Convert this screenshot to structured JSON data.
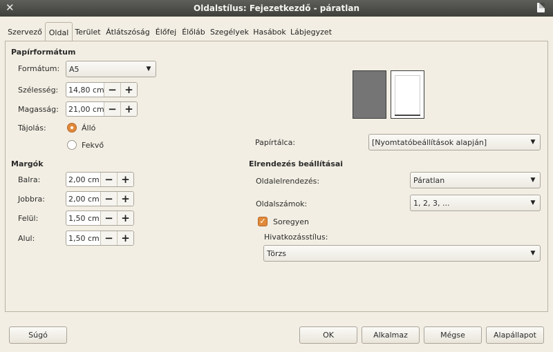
{
  "window": {
    "title": "Oldalstílus: Fejezetkezdő - páratlan"
  },
  "tabs": [
    "Szervező",
    "Oldal",
    "Terület",
    "Átlátszóság",
    "Élőfej",
    "Élőláb",
    "Szegélyek",
    "Hasábok",
    "Lábjegyzet"
  ],
  "paper": {
    "heading": "Papírformátum",
    "format_label": "Formátum:",
    "format_value": "A5",
    "width_label": "Szélesség:",
    "width_value": "14,80 cm",
    "height_label": "Magasság:",
    "height_value": "21,00 cm",
    "orientation_label": "Tájolás:",
    "portrait_label": "Álló",
    "landscape_label": "Fekvő",
    "tray_label": "Papírtálca:",
    "tray_value": "[Nyomtatóbeállítások alapján]"
  },
  "margins": {
    "heading": "Margók",
    "left_label": "Balra:",
    "left_value": "2,00 cm",
    "right_label": "Jobbra:",
    "right_value": "2,00 cm",
    "top_label": "Felül:",
    "top_value": "1,50 cm",
    "bottom_label": "Alul:",
    "bottom_value": "1,50 cm"
  },
  "layout": {
    "heading": "Elrendezés beállításai",
    "page_layout_label": "Oldalelrendezés:",
    "page_layout_value": "Páratlan",
    "numbering_label": "Oldalszámok:",
    "numbering_value": "1, 2, 3, ...",
    "register_label": "Soregyen",
    "register_checked": true,
    "ref_style_label": "Hivatkozásstílus:",
    "ref_style_value": "Törzs"
  },
  "spin": {
    "minus": "−",
    "plus": "+"
  },
  "buttons": {
    "help": "Súgó",
    "ok": "OK",
    "apply": "Alkalmaz",
    "cancel": "Mégse",
    "reset": "Alapállapot"
  },
  "colors": {
    "accent": "#e08a3a",
    "background": "#f2eee3",
    "titlebar": "#4a4a47"
  }
}
